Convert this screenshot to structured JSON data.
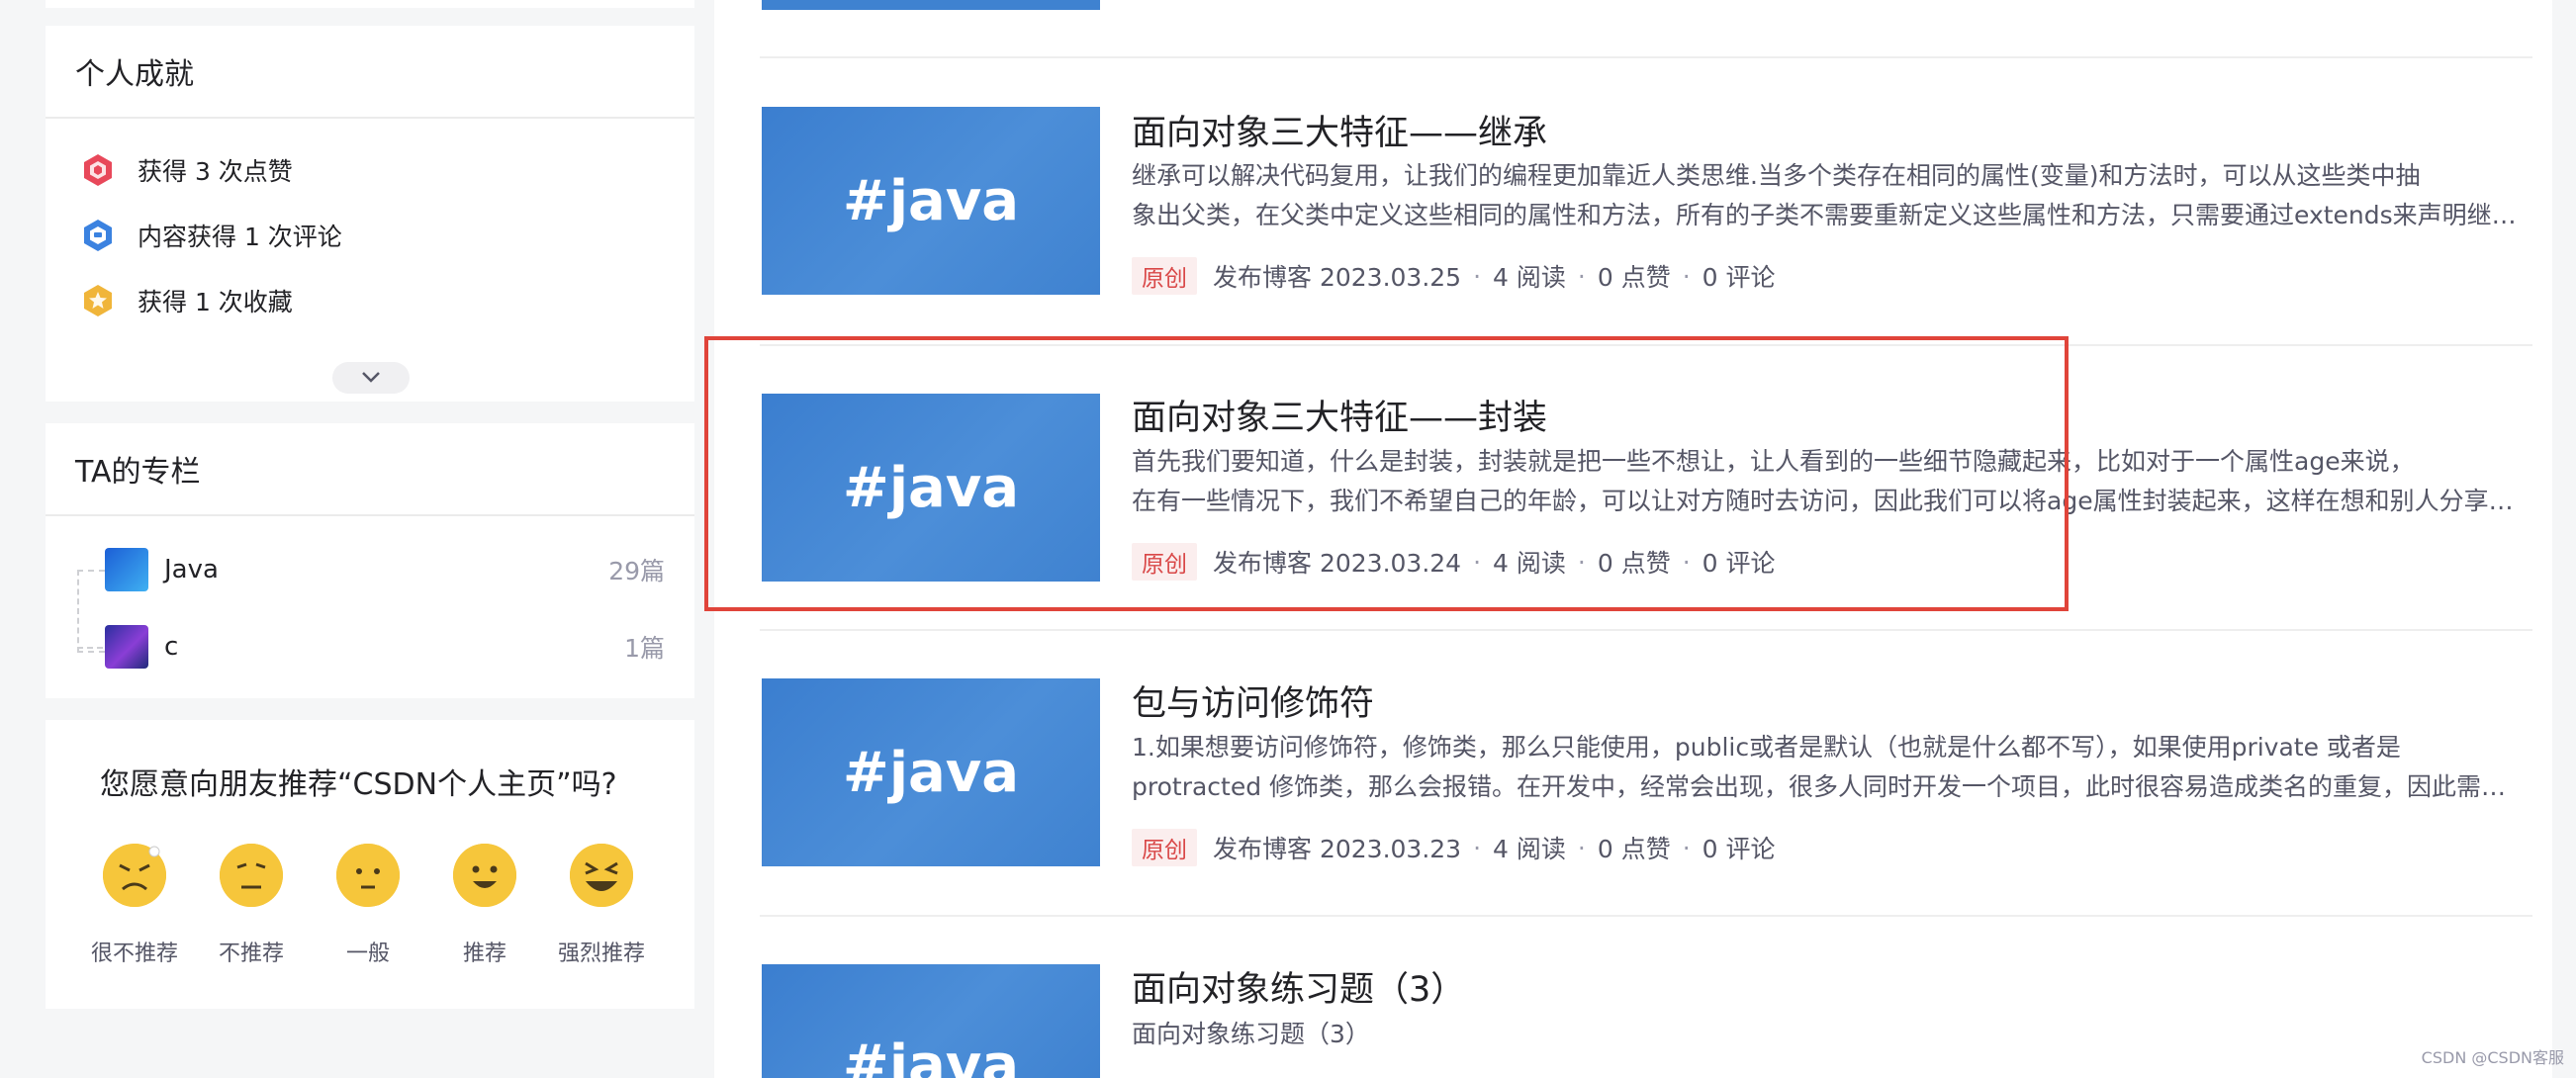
{
  "sidebar": {
    "achievements": {
      "title": "个人成就",
      "items": [
        {
          "label": "获得 3 次点赞",
          "icon": "like-medal-icon",
          "color": "#e8485a"
        },
        {
          "label": "内容获得 1 次评论",
          "icon": "comment-medal-icon",
          "color": "#3b82e0"
        },
        {
          "label": "获得 1 次收藏",
          "icon": "favorite-medal-icon",
          "color": "#f0b53a"
        }
      ]
    },
    "columns": {
      "title": "TA的专栏",
      "items": [
        {
          "name": "Java",
          "count": "29篇",
          "icon": "java-column-icon"
        },
        {
          "name": "c",
          "count": "1篇",
          "icon": "c-column-icon"
        }
      ]
    },
    "recommend": {
      "question": "您愿意向朋友推荐“CSDN个人主页”吗?",
      "options": [
        {
          "label": "很不推荐",
          "icon": "angry-face-icon"
        },
        {
          "label": "不推荐",
          "icon": "unhappy-face-icon"
        },
        {
          "label": "一般",
          "icon": "neutral-face-icon"
        },
        {
          "label": "推荐",
          "icon": "smile-face-icon"
        },
        {
          "label": "强烈推荐",
          "icon": "laughing-face-icon"
        }
      ]
    }
  },
  "articles": [
    {
      "thumb_text": "#java",
      "title": "面向对象三大特征——继承",
      "desc_line1": "继承可以解决代码复用，让我们的编程更加靠近人类思维.当多个类存在相同的属性(变量)和方法时，可以从这些类中抽",
      "desc_line2": "象出父类，在父类中定义这些相同的属性和方法，所有的子类不需要重新定义这些属性和方法，只需要通过extends来声明继承父类即可。",
      "badge": "原创",
      "date": "发布博客 2023.03.25",
      "reads": "4 阅读",
      "likes": "0 点赞",
      "comments": "0 评论"
    },
    {
      "thumb_text": "#java",
      "title": "面向对象三大特征——封装",
      "desc_line1": "首先我们要知道，什么是封装，封装就是把一些不想让，让人看到的一些细节隐藏起来，比如对于一个属性age来说，",
      "desc_line2": "在有一些情况下，我们不希望自己的年龄，可以让对方随时去访问，因此我们可以将age属性封装起来，这样在想和别人分享时再去调用。",
      "badge": "原创",
      "date": "发布博客 2023.03.24",
      "reads": "4 阅读",
      "likes": "0 点赞",
      "comments": "0 评论"
    },
    {
      "thumb_text": "#java",
      "title": "包与访问修饰符",
      "desc_line1": "1.如果想要访问修饰符，修饰类，那么只能使用，public或者是默认（也就是什么都不写），如果使用private 或者是",
      "desc_line2": "protracted 修饰类，那么会报错。在开发中，经常会出现，很多人同时开发一个项目，此时很容易造成类名的重复，因此需要使用包。",
      "badge": "原创",
      "date": "发布博客 2023.03.23",
      "reads": "4 阅读",
      "likes": "0 点赞",
      "comments": "0 评论"
    },
    {
      "thumb_text": "#java",
      "title": "面向对象练习题（3）",
      "desc_line1": "面向对象练习题（3）"
    }
  ],
  "watermark": "CSDN @CSDN客服"
}
